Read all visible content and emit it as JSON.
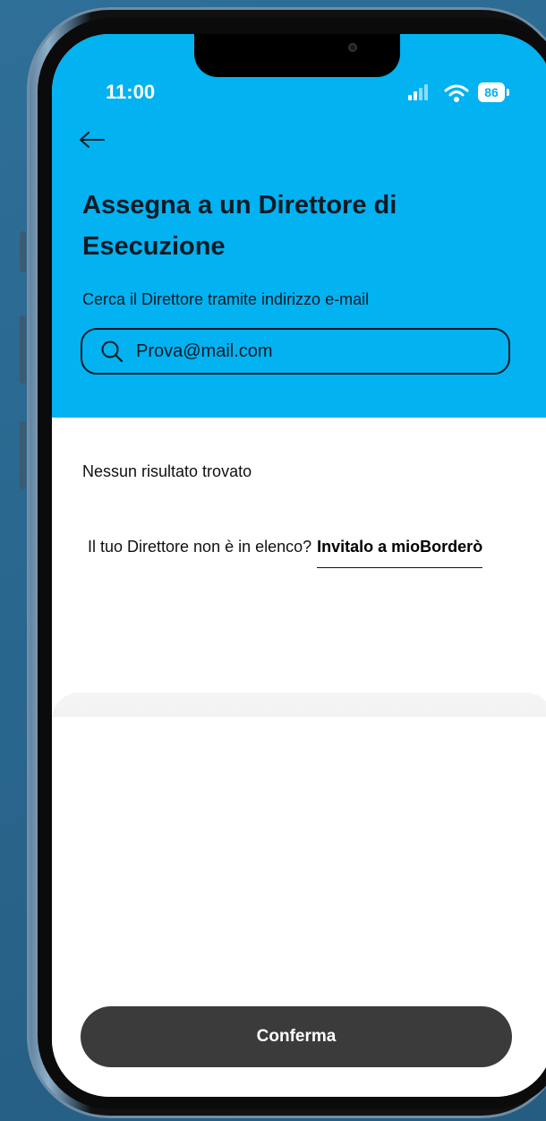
{
  "status_bar": {
    "time": "11:00",
    "battery": "86",
    "signal_icon": "signal-icon",
    "wifi_icon": "wifi-icon"
  },
  "header": {
    "back_icon": "arrow-left-icon",
    "title": "Assegna a un Direttore di Esecuzione",
    "subtitle": "Cerca il Direttore tramite indirizzo e-mail"
  },
  "search": {
    "icon": "search-icon",
    "value": "Prova@mail.com"
  },
  "results": {
    "empty_message": "Nessun risultato trovato",
    "invite_prompt": "Il tuo Direttore non è in elenco?",
    "invite_link": "Invitalo a mioBorderò"
  },
  "footer": {
    "confirm_label": "Conferma"
  },
  "colors": {
    "accent": "#02b2f1",
    "text": "#0e1b24",
    "button": "#3b3b3b"
  }
}
